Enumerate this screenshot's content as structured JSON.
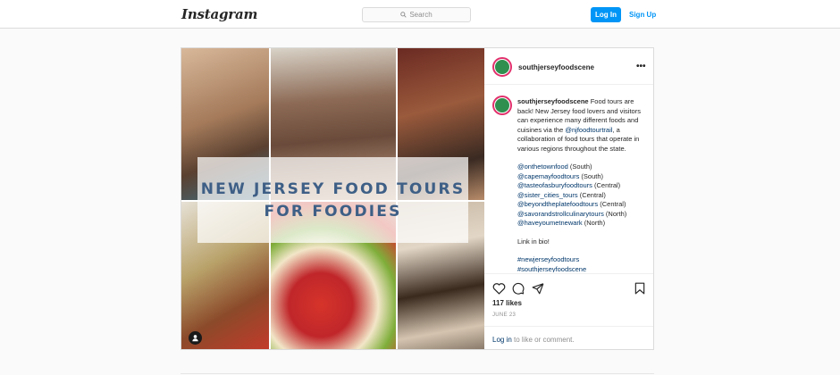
{
  "nav": {
    "logo": "Instagram",
    "search_placeholder": "Search",
    "login_label": "Log In",
    "signup_label": "Sign Up"
  },
  "post": {
    "username": "southjerseyfoodscene",
    "banner": {
      "line1": "NEW JERSEY FOOD TOURS",
      "line2": "FOR FOODIES"
    },
    "caption": {
      "p1_a": "Food tours are back! New Jersey food lovers and visitors can experience many different foods and cuisines via the ",
      "p1_link": "@njfoodtourtrail",
      "p1_b": ", a collaboration of food tours that operate in various regions throughout the state.",
      "mentions": [
        {
          "handle": "@onthetownfood",
          "region": " (South)"
        },
        {
          "handle": "@capemayfoodtours",
          "region": " (South)"
        },
        {
          "handle": "@tasteofasburyfoodtours",
          "region": " (Central)"
        },
        {
          "handle": "@sister_cities_tours",
          "region": " (Central)"
        },
        {
          "handle": "@beyondtheplatefoodtours",
          "region": " (Central)"
        },
        {
          "handle": "@savorandstrollculinarytours",
          "region": " (North)"
        },
        {
          "handle": "@haveyoumetnewark",
          "region": " (North)"
        }
      ],
      "link_in_bio": "Link in bio!",
      "hashtag": "#newjerseyfoodtours",
      "hashtag2": "#southjerseyfoodscene"
    },
    "likes": "117 likes",
    "date": "JUNE 23",
    "login_link": "Log in",
    "login_rest": " to like or comment."
  },
  "colors": {
    "accent": "#0095f6",
    "link": "#00376b",
    "banner_text": "#3e5f86"
  },
  "icons": [
    "search-icon",
    "more-options-icon",
    "heart-icon",
    "comment-icon",
    "share-icon",
    "bookmark-icon",
    "user-tag-icon"
  ]
}
